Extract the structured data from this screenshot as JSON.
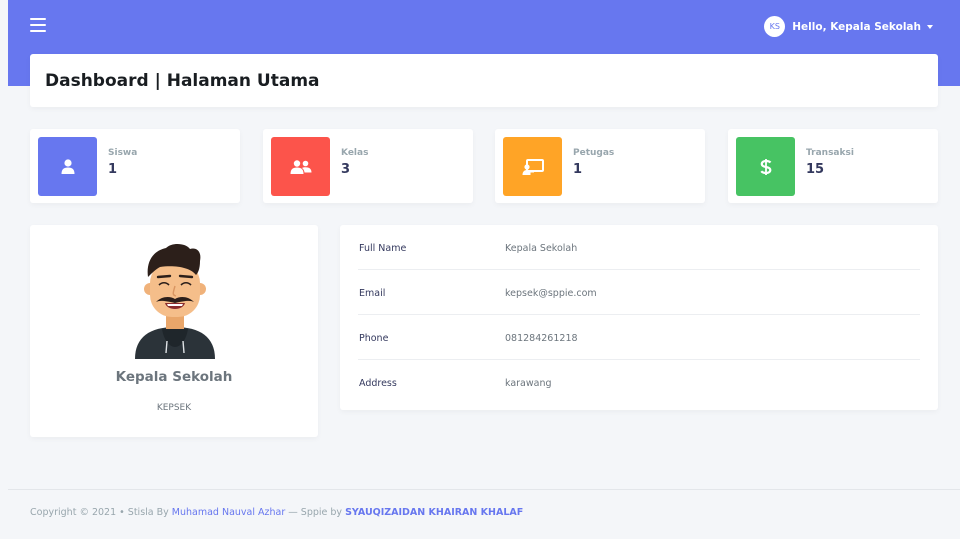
{
  "navbar": {
    "avatar_initials": "KS",
    "greeting": "Hello, Kepala Sekolah"
  },
  "header": {
    "title": "Dashboard | Halaman Utama"
  },
  "stats": [
    {
      "label": "Siswa",
      "value": "1",
      "icon": "user-icon",
      "color": "#6777ef"
    },
    {
      "label": "Kelas",
      "value": "3",
      "icon": "users-icon",
      "color": "#fc544b"
    },
    {
      "label": "Petugas",
      "value": "1",
      "icon": "chalkboard-teacher-icon",
      "color": "#ffa426"
    },
    {
      "label": "Transaksi",
      "value": "15",
      "icon": "dollar-icon",
      "color": "#47c363"
    }
  ],
  "profile": {
    "name": "Kepala Sekolah",
    "role": "KEPSEK"
  },
  "details": [
    {
      "key": "Full Name",
      "value": "Kepala Sekolah"
    },
    {
      "key": "Email",
      "value": "kepsek@sppie.com"
    },
    {
      "key": "Phone",
      "value": "081284261218"
    },
    {
      "key": "Address",
      "value": "karawang"
    }
  ],
  "footer": {
    "copyright": "Copyright © 2021",
    "sep": " • ",
    "stisla_by": "Stisla By ",
    "author1": "Muhamad Nauval Azhar",
    "dash": " — Sppie by ",
    "author2": "SYAUQIZAIDAN KHAIRAN KHALAF"
  }
}
